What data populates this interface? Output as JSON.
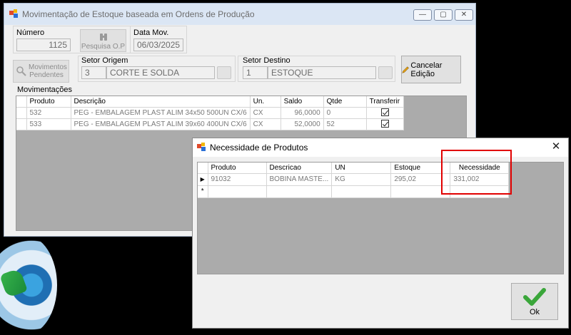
{
  "main_window": {
    "title": "Movimentação de Estoque baseada em Ordens de Produção",
    "numero": {
      "label": "Número",
      "value": "1125"
    },
    "pesquisa_op_label": "Pesquisa O.P",
    "data_mov": {
      "label": "Data Mov.",
      "value": "06/03/2025"
    },
    "movimentos_pendentes_label": "Movimentos Pendentes",
    "setor_origem": {
      "label": "Setor Origem",
      "code": "3",
      "name": "CORTE E SOLDA"
    },
    "setor_destino": {
      "label": "Setor Destino",
      "code": "1",
      "name": "ESTOQUE"
    },
    "cancelar_label": "Cancelar Edição",
    "movimentacoes_label": "Movimentações",
    "grid": {
      "columns": [
        "Produto",
        "Descrição",
        "Un.",
        "Saldo",
        "Qtde",
        "Transferir"
      ],
      "rows": [
        {
          "produto": "532",
          "descricao": "PEG - EMBALAGEM PLAST ALIM 34x50 500UN CX/6",
          "un": "CX",
          "saldo": "96,0000",
          "qtde": "0",
          "transferir": true
        },
        {
          "produto": "533",
          "descricao": "PEG - EMBALAGEM PLAST ALIM 39x60 400UN CX/6",
          "un": "CX",
          "saldo": "52,0000",
          "qtde": "52",
          "transferir": true
        }
      ]
    }
  },
  "dialog": {
    "title": "Necessidade de Produtos",
    "close_glyph": "✕",
    "columns": [
      "Produto",
      "Descricao",
      "UN",
      "Estoque",
      "Necessidade"
    ],
    "rows": [
      {
        "produto": "91032",
        "descricao": "BOBINA MASTE...",
        "un": "KG",
        "estoque": "295,02",
        "necessidade": "331,002"
      }
    ],
    "ok_label": "Ok"
  },
  "icons": {
    "app": "app-icon",
    "search": "magnifier-icon",
    "binoculars": "binoculars-icon",
    "pencil": "pencil-icon",
    "check": "check-icon"
  },
  "colors": {
    "highlight": "#e10000",
    "titlebar": "#dbe6f4",
    "grid_bg": "#ababab"
  }
}
